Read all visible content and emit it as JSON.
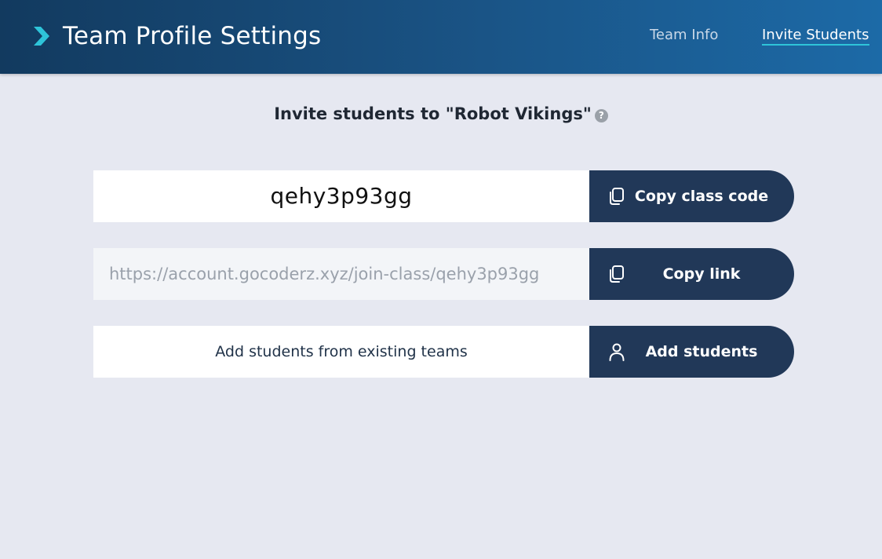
{
  "header": {
    "title": "Team Profile Settings",
    "tabs": [
      {
        "label": "Team Info",
        "active": false
      },
      {
        "label": "Invite Students",
        "active": true
      }
    ]
  },
  "invite": {
    "heading": "Invite students to \"Robot Vikings\"",
    "help_icon_glyph": "?",
    "class_code": "qehy3p93gg",
    "copy_code_label": "Copy class code",
    "join_link": "https://account.gocoderz.xyz/join-class/qehy3p93gg",
    "copy_link_label": "Copy link",
    "add_text": "Add students from existing teams",
    "add_students_label": "Add students"
  },
  "icons": {
    "logo": "chevron-right-icon",
    "copy": "copy-icon",
    "user": "user-icon",
    "help": "help-icon"
  },
  "colors": {
    "header_start": "#123a5f",
    "header_end": "#1c6aa7",
    "accent": "#2ec4d9",
    "button": "#213858",
    "background": "#e6e8f1"
  }
}
